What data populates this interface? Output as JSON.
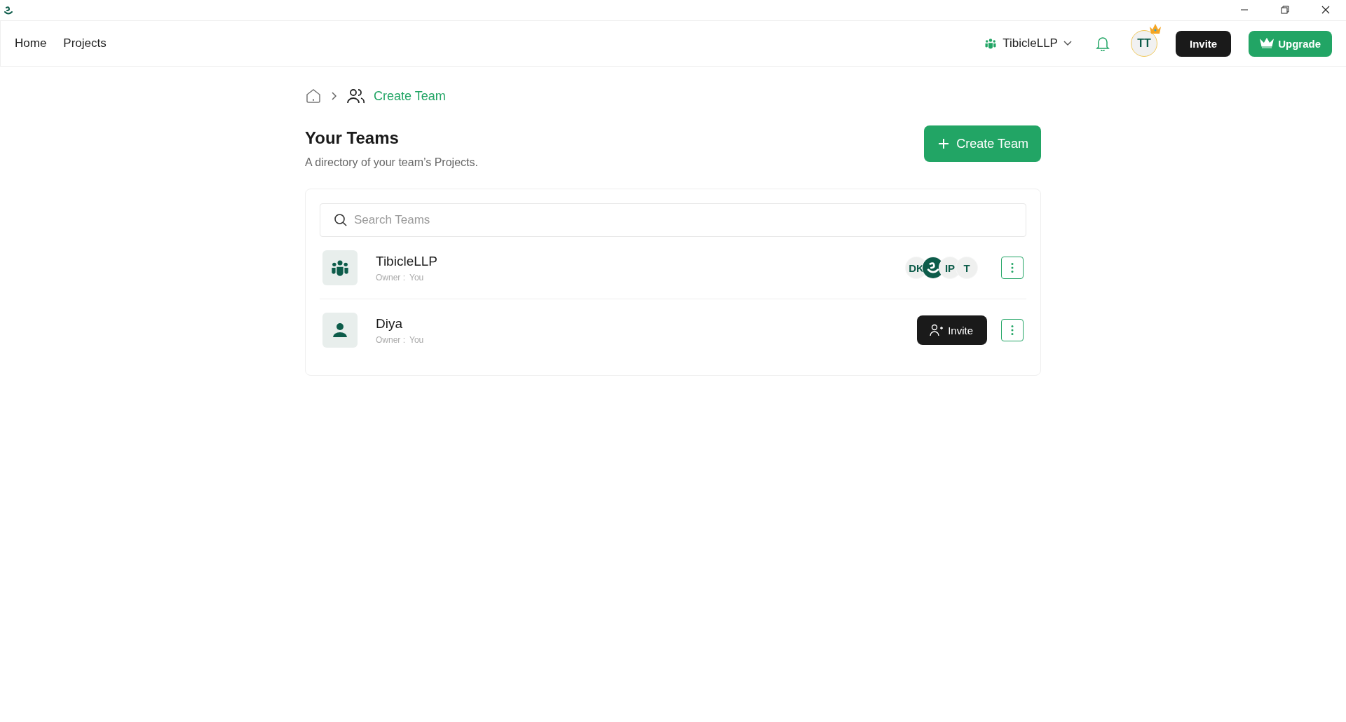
{
  "nav": {
    "links": [
      {
        "label": "Home"
      },
      {
        "label": "Projects"
      }
    ],
    "workspace": "TibicleLLP",
    "avatar": "TT",
    "invite": "Invite",
    "upgrade": "Upgrade"
  },
  "breadcrumb": {
    "current": "Create Team"
  },
  "header": {
    "title": "Your Teams",
    "subtitle": "A directory of your team’s Projects.",
    "create_button": "Create Team"
  },
  "search": {
    "placeholder": "Search Teams"
  },
  "teams": [
    {
      "kind": "group",
      "name": "TibicleLLP",
      "owner_label": "Owner :",
      "owner": "You",
      "members": [
        {
          "kind": "initials",
          "text": "DK"
        },
        {
          "kind": "logo"
        },
        {
          "kind": "initials",
          "text": "IP"
        },
        {
          "kind": "initials",
          "text": "T"
        }
      ]
    },
    {
      "kind": "person",
      "name": "Diya",
      "owner_label": "Owner :",
      "owner": "You",
      "invite": "Invite"
    }
  ]
}
